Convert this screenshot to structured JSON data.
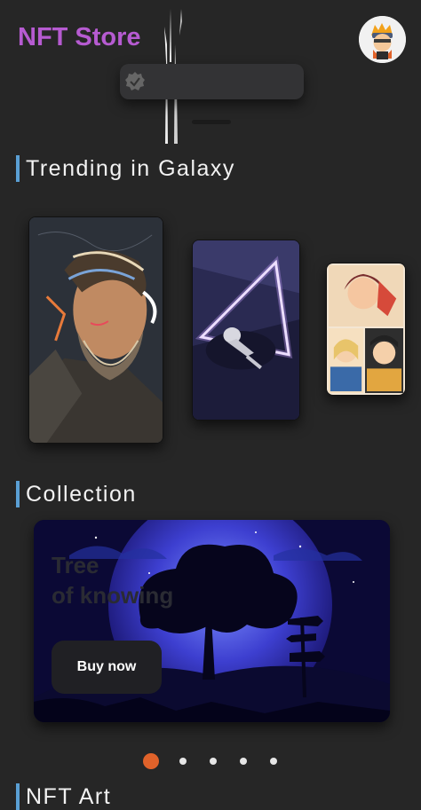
{
  "header": {
    "title": "NFT Store",
    "avatar_icon": "ninja-avatar-icon"
  },
  "toast": {
    "icon": "check-badge-icon"
  },
  "sections": {
    "trending": "Trending in Galaxy",
    "collection": "Collection",
    "nft_art": "NFT Art"
  },
  "trending_cards": [
    {
      "name": "bearded-man-artwork"
    },
    {
      "name": "astronaut-triangle-artwork"
    },
    {
      "name": "anime-portraits-artwork"
    }
  ],
  "banner": {
    "title_line1": "Tree",
    "title_line2": "of knowing",
    "button_label": "Buy now"
  },
  "pagination": {
    "count": 5,
    "active_index": 0
  },
  "colors": {
    "background": "#262626",
    "brand_title": "#b65bd1",
    "section_bar": "#5a9fd4",
    "active_dot": "#e0622a"
  }
}
